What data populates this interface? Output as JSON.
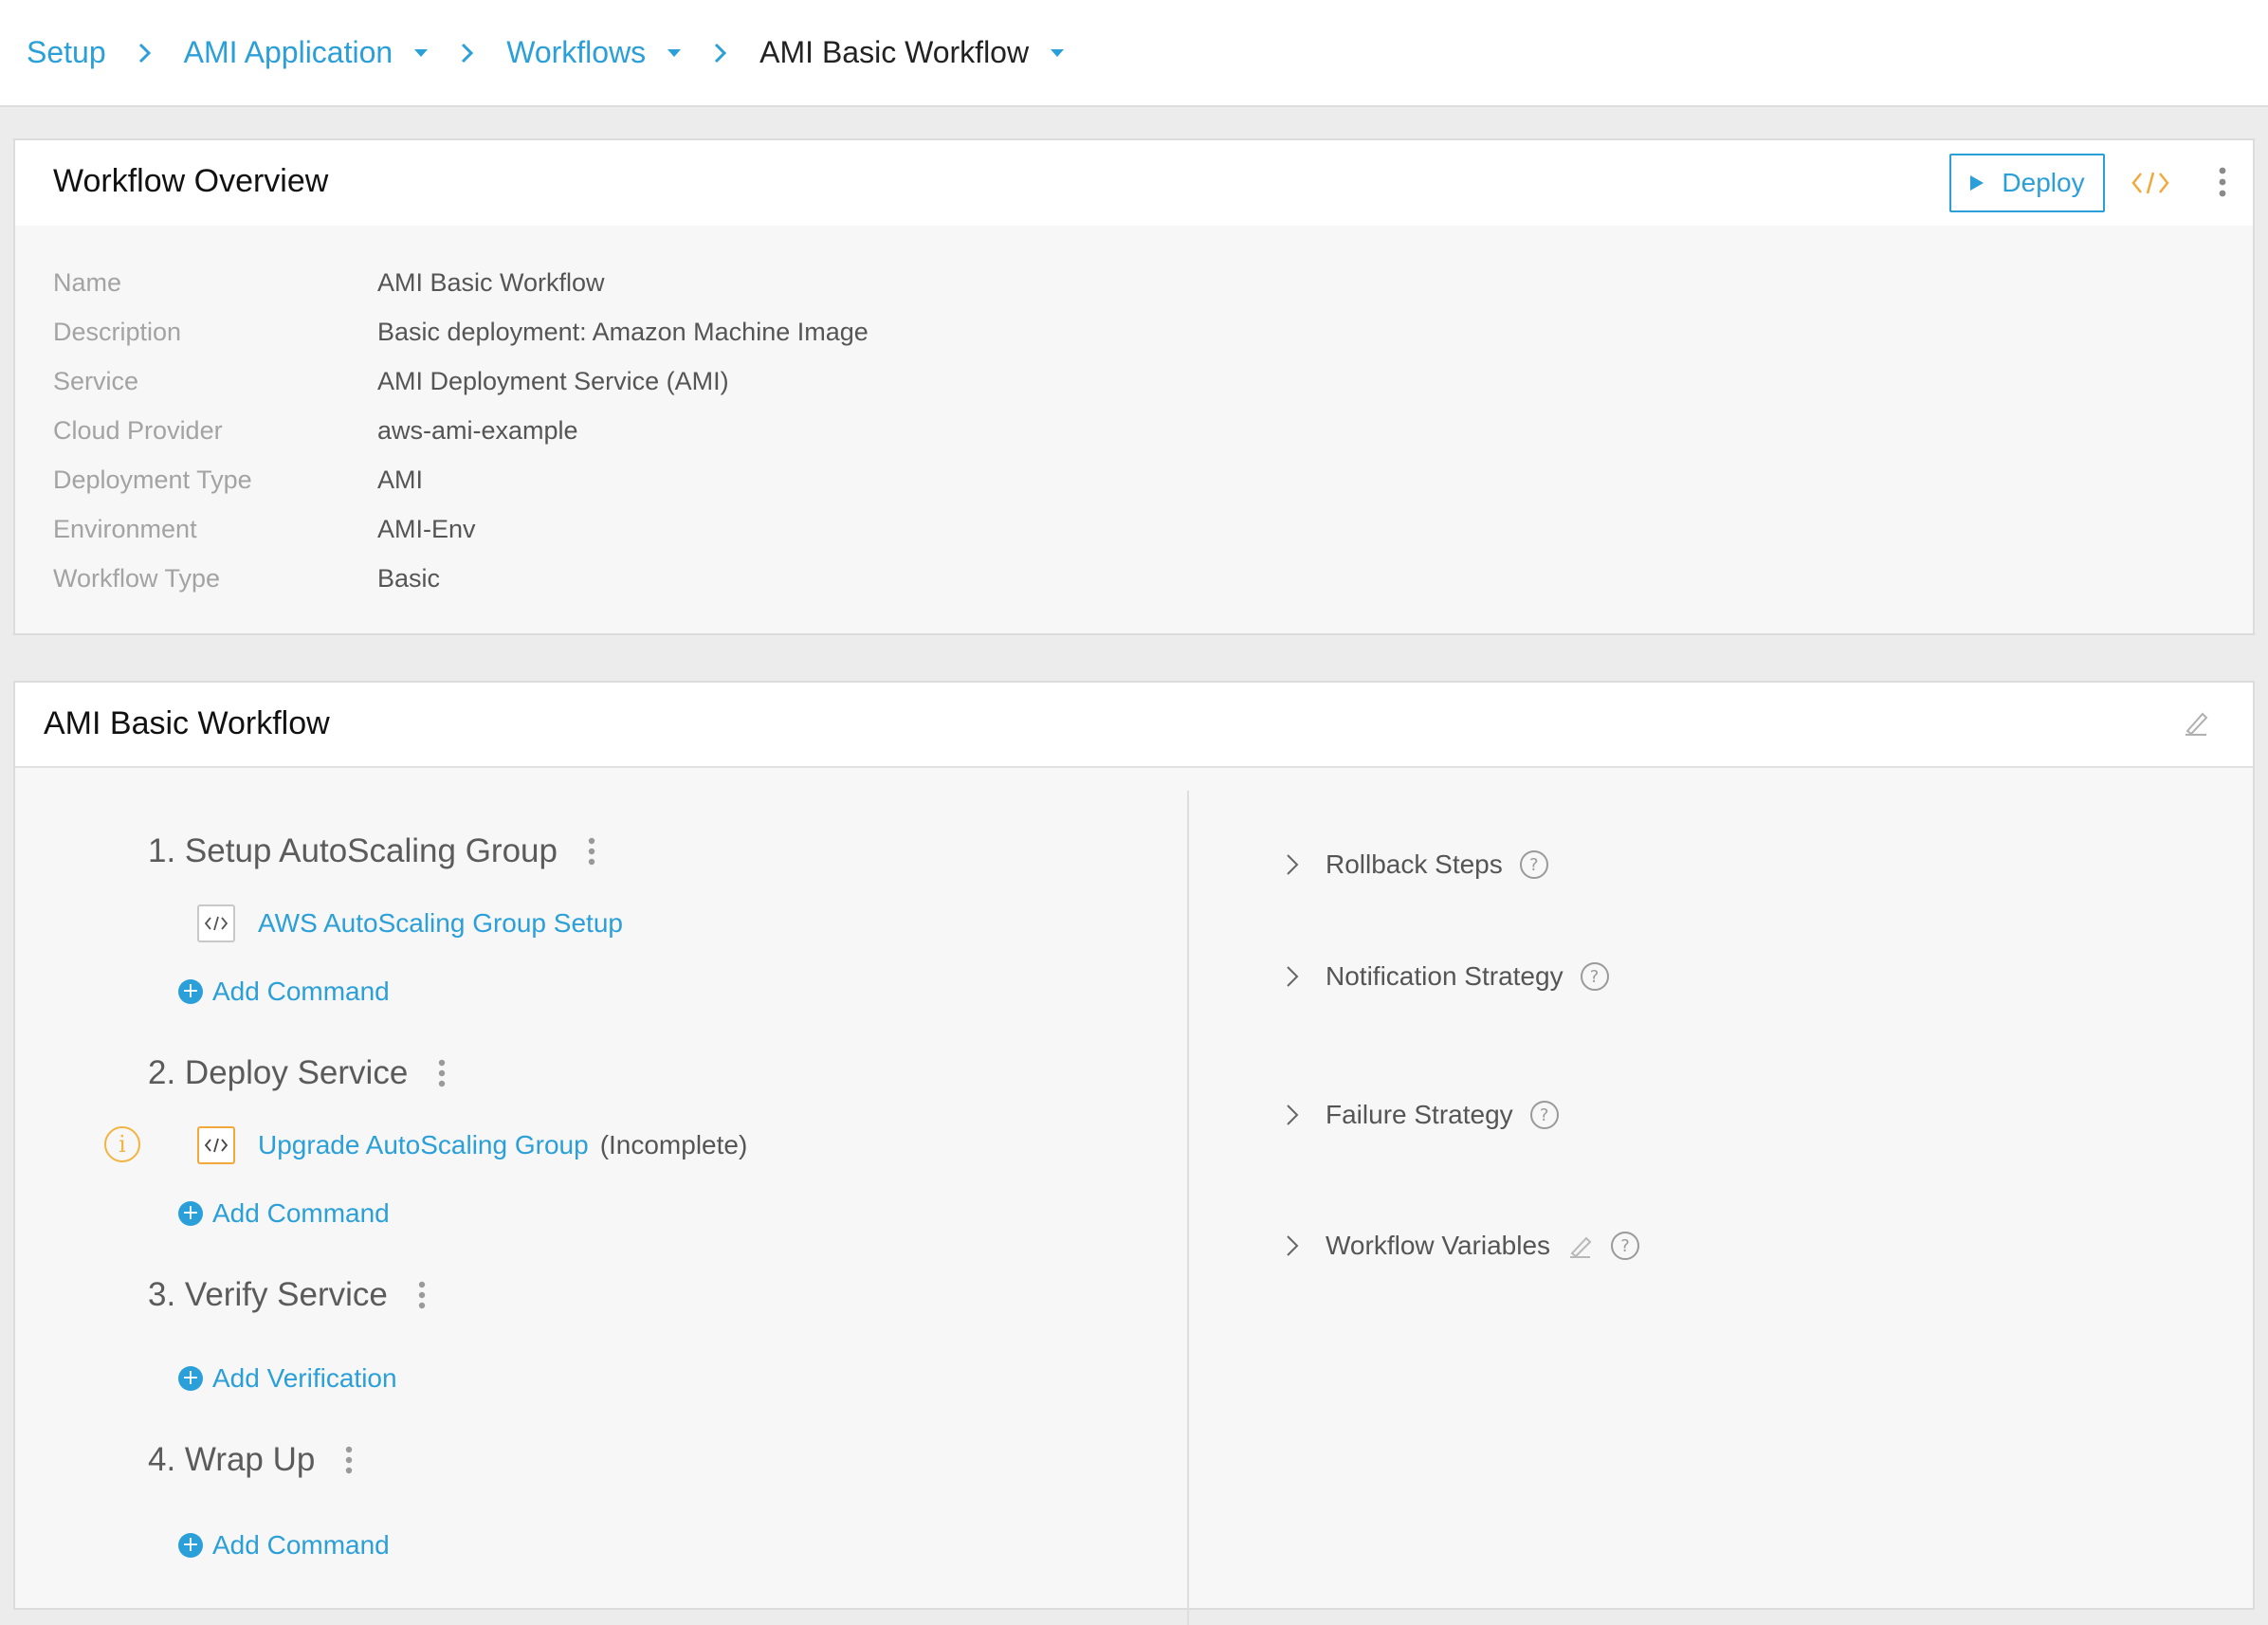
{
  "breadcrumb": {
    "items": [
      {
        "label": "Setup"
      },
      {
        "label": "AMI Application"
      },
      {
        "label": "Workflows"
      },
      {
        "label": "AMI Basic Workflow"
      }
    ]
  },
  "overview": {
    "title": "Workflow Overview",
    "deploy_label": "Deploy",
    "fields": [
      {
        "label": "Name",
        "value": "AMI Basic Workflow"
      },
      {
        "label": "Description",
        "value": "Basic deployment: Amazon Machine Image"
      },
      {
        "label": "Service",
        "value": "AMI Deployment Service (AMI)"
      },
      {
        "label": "Cloud Provider",
        "value": "aws-ami-example"
      },
      {
        "label": "Deployment Type",
        "value": "AMI"
      },
      {
        "label": "Environment",
        "value": "AMI-Env"
      },
      {
        "label": "Workflow Type",
        "value": "Basic"
      }
    ]
  },
  "workflow": {
    "title": "AMI Basic Workflow",
    "phases": [
      {
        "title": "1. Setup AutoScaling Group",
        "step": "AWS AutoScaling Group Setup",
        "add_label": "Add Command"
      },
      {
        "title": "2. Deploy Service",
        "step": "Upgrade AutoScaling Group",
        "step_note": "(Incomplete)",
        "info": "i",
        "add_label": "Add Command"
      },
      {
        "title": "3. Verify Service",
        "add_label": "Add Verification"
      },
      {
        "title": "4. Wrap Up",
        "add_label": "Add Command"
      }
    ],
    "side": [
      {
        "label": "Rollback Steps"
      },
      {
        "label": "Notification Strategy"
      },
      {
        "label": "Failure Strategy"
      },
      {
        "label": "Workflow Variables"
      }
    ],
    "help_glyph": "?",
    "plus_glyph": "+"
  },
  "colors": {
    "accent": "#2b9fd8",
    "warning": "#f2a93b",
    "code_icon": "#f2a93b"
  }
}
